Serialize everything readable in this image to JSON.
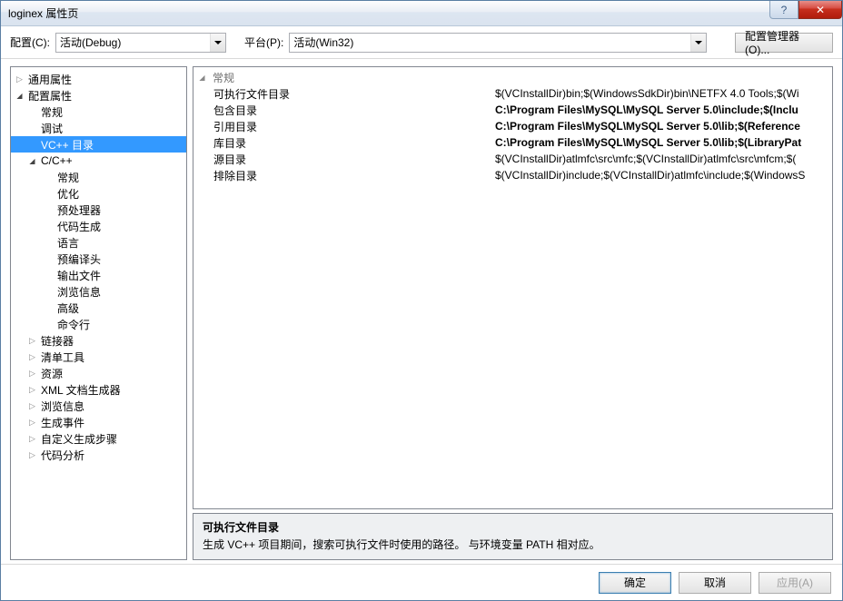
{
  "title": "loginex 属性页",
  "toolbar": {
    "configLabel": "配置(C):",
    "configValue": "活动(Debug)",
    "platformLabel": "平台(P):",
    "platformValue": "活动(Win32)",
    "managerLabel": "配置管理器(O)..."
  },
  "tree": [
    {
      "indent": 0,
      "exp": "collapsed",
      "label": "通用属性"
    },
    {
      "indent": 0,
      "exp": "expanded",
      "label": "配置属性"
    },
    {
      "indent": 1,
      "exp": "none",
      "label": "常规"
    },
    {
      "indent": 1,
      "exp": "none",
      "label": "调试"
    },
    {
      "indent": 1,
      "exp": "none",
      "label": "VC++ 目录",
      "selected": true
    },
    {
      "indent": 1,
      "exp": "expanded",
      "label": "C/C++"
    },
    {
      "indent": 2,
      "exp": "none",
      "label": "常规"
    },
    {
      "indent": 2,
      "exp": "none",
      "label": "优化"
    },
    {
      "indent": 2,
      "exp": "none",
      "label": "预处理器"
    },
    {
      "indent": 2,
      "exp": "none",
      "label": "代码生成"
    },
    {
      "indent": 2,
      "exp": "none",
      "label": "语言"
    },
    {
      "indent": 2,
      "exp": "none",
      "label": "预编译头"
    },
    {
      "indent": 2,
      "exp": "none",
      "label": "输出文件"
    },
    {
      "indent": 2,
      "exp": "none",
      "label": "浏览信息"
    },
    {
      "indent": 2,
      "exp": "none",
      "label": "高级"
    },
    {
      "indent": 2,
      "exp": "none",
      "label": "命令行"
    },
    {
      "indent": 1,
      "exp": "collapsed",
      "label": "链接器"
    },
    {
      "indent": 1,
      "exp": "collapsed",
      "label": "清单工具"
    },
    {
      "indent": 1,
      "exp": "collapsed",
      "label": "资源"
    },
    {
      "indent": 1,
      "exp": "collapsed",
      "label": "XML 文档生成器"
    },
    {
      "indent": 1,
      "exp": "collapsed",
      "label": "浏览信息"
    },
    {
      "indent": 1,
      "exp": "collapsed",
      "label": "生成事件"
    },
    {
      "indent": 1,
      "exp": "collapsed",
      "label": "自定义生成步骤"
    },
    {
      "indent": 1,
      "exp": "collapsed",
      "label": "代码分析"
    }
  ],
  "group": "常规",
  "props": [
    {
      "label": "可执行文件目录",
      "value": "$(VCInstallDir)bin;$(WindowsSdkDir)bin\\NETFX 4.0 Tools;$(Wi",
      "bold": false
    },
    {
      "label": "包含目录",
      "value": "C:\\Program Files\\MySQL\\MySQL Server 5.0\\include;$(Inclu",
      "bold": true
    },
    {
      "label": "引用目录",
      "value": "C:\\Program Files\\MySQL\\MySQL Server 5.0\\lib;$(Reference",
      "bold": true
    },
    {
      "label": "库目录",
      "value": "C:\\Program Files\\MySQL\\MySQL Server 5.0\\lib;$(LibraryPat",
      "bold": true
    },
    {
      "label": "源目录",
      "value": "$(VCInstallDir)atlmfc\\src\\mfc;$(VCInstallDir)atlmfc\\src\\mfcm;$(",
      "bold": false
    },
    {
      "label": "排除目录",
      "value": "$(VCInstallDir)include;$(VCInstallDir)atlmfc\\include;$(WindowsS",
      "bold": false
    }
  ],
  "desc": {
    "title": "可执行文件目录",
    "text": "生成 VC++ 项目期间，搜索可执行文件时使用的路径。 与环境变量 PATH 相对应。"
  },
  "buttons": {
    "ok": "确定",
    "cancel": "取消",
    "apply": "应用(A)"
  }
}
